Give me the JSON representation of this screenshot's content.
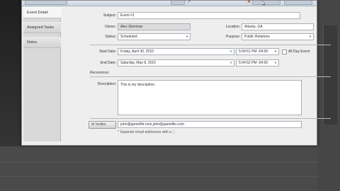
{
  "tabs": [
    {
      "label": "Event Detail",
      "active": true
    },
    {
      "label": "Assigned Tasks",
      "active": false
    },
    {
      "label": "Notes",
      "active": false
    }
  ],
  "form": {
    "subject": {
      "label": "Subject:",
      "value": "Event #1"
    },
    "owner": {
      "label": "Owner:",
      "value": "Alex Sherman"
    },
    "location": {
      "label": "Location:",
      "value": "Atlanta, GA"
    },
    "status": {
      "label": "Status:",
      "value": "Scheduled"
    },
    "purpose": {
      "label": "Purpose:",
      "value": "Public Relations"
    },
    "start": {
      "label": "Start Date:",
      "date": "Friday, April 30, 2010",
      "time": "5:04:51 PM -04:00"
    },
    "end": {
      "label": "End Date:",
      "date": "Saturday, May 8, 2010",
      "time": "5:04:52 PM -04:00"
    },
    "all_day": {
      "label": "All Day Event",
      "checked": false
    },
    "recurrence": {
      "label": "Recurrence:"
    },
    "description": {
      "label": "Description:",
      "value": "This is my description."
    },
    "invites": {
      "button_label": "Invites",
      "value": "john@gamefiltr.com,john@gamefilo.com",
      "hint": "* Separate email addresses with a ','."
    }
  },
  "colors": {
    "window_bg": "#eeeeee",
    "toolbar": "#cfd7e2",
    "readonly_field": "#dcdcdc"
  },
  "icons": [
    "close-icon",
    "arrow-icon",
    "dropdown-arrow-icon",
    "invite-icon",
    "mouse-cursor-icon"
  ]
}
